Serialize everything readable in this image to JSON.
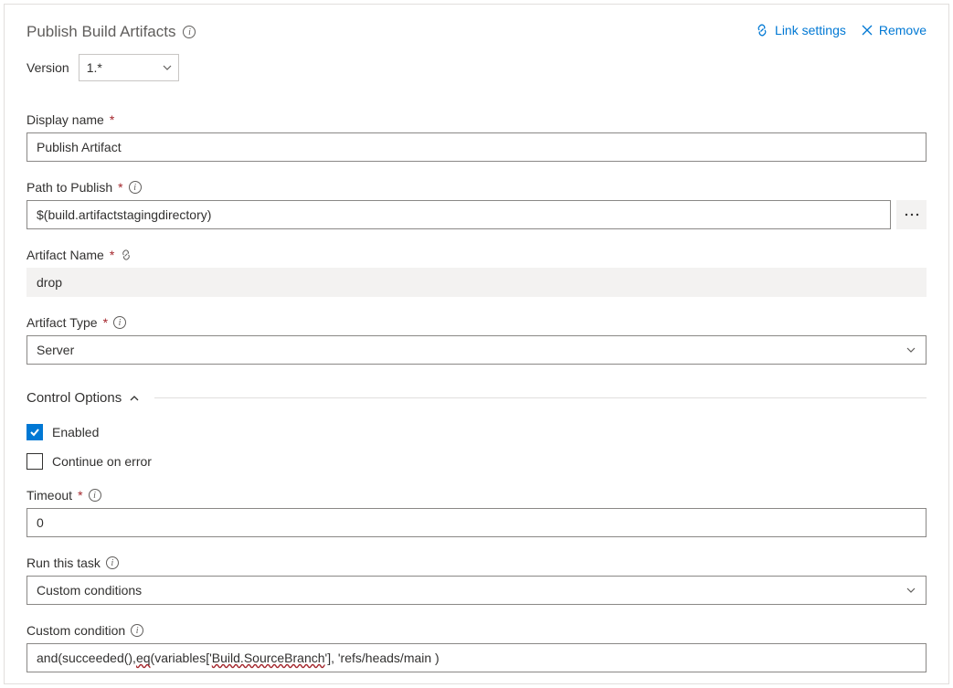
{
  "header": {
    "title": "Publish Build Artifacts",
    "link_settings": "Link settings",
    "remove": "Remove"
  },
  "version": {
    "label": "Version",
    "value": "1.*"
  },
  "fields": {
    "display_name": {
      "label": "Display name",
      "value": "Publish Artifact"
    },
    "path_to_publish": {
      "label": "Path to Publish",
      "value": "$(build.artifactstagingdirectory)"
    },
    "artifact_name": {
      "label": "Artifact Name",
      "value": "drop"
    },
    "artifact_type": {
      "label": "Artifact Type",
      "value": "Server"
    }
  },
  "control_options": {
    "header": "Control Options",
    "enabled": {
      "label": "Enabled",
      "checked": true
    },
    "continue_on_error": {
      "label": "Continue on error",
      "checked": false
    },
    "timeout": {
      "label": "Timeout",
      "value": "0"
    },
    "run_this_task": {
      "label": "Run this task",
      "value": "Custom conditions"
    },
    "custom_condition": {
      "label": "Custom condition",
      "prefix": "and(succeeded(), ",
      "fn": "eq",
      "err_segment": "Build.SourceBranch",
      "open": "(variables['",
      "suffix": "'], 'refs/heads/main )"
    }
  }
}
